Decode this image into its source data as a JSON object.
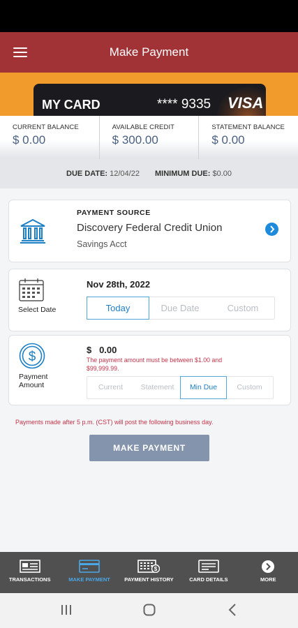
{
  "app": {
    "title": "Make Payment"
  },
  "card": {
    "name": "MY CARD",
    "number": "**** 9335",
    "brand": "VISA"
  },
  "balances": [
    {
      "label": "CURRENT BALANCE",
      "value": "$ 0.00"
    },
    {
      "label": "AVAILABLE CREDIT",
      "value": "$ 300.00"
    },
    {
      "label": "STATEMENT BALANCE",
      "value": "$ 0.00"
    }
  ],
  "due": {
    "date_label": "DUE DATE:",
    "date_value": "12/04/22",
    "min_label": "MINIMUM DUE:",
    "min_value": "$0.00"
  },
  "source": {
    "label": "PAYMENT SOURCE",
    "name": "Discovery Federal Credit Union",
    "account": "Savings Acct"
  },
  "date": {
    "label": "Select Date",
    "value": "Nov 28th, 2022",
    "options": [
      "Today",
      "Due Date",
      "Custom"
    ],
    "selected": "Today"
  },
  "amount": {
    "label_line1": "Payment",
    "label_line2": "Amount",
    "value": "$   0.00",
    "error": "The payment amount must be between $1.00 and $99,999.99.",
    "options": [
      "Current",
      "Statement",
      "Min Due",
      "Custom"
    ],
    "selected": "Min Due"
  },
  "note": "Payments made after 5 p.m. (CST) will post the following business day.",
  "pay_button": "MAKE PAYMENT",
  "tabs": [
    {
      "label": "TRANSACTIONS",
      "icon": "transactions-icon"
    },
    {
      "label": "MAKE PAYMENT",
      "icon": "payment-card-icon",
      "active": true
    },
    {
      "label": "PAYMENT HISTORY",
      "icon": "payment-history-icon"
    },
    {
      "label": "CARD DETAILS",
      "icon": "card-details-icon"
    },
    {
      "label": "MORE",
      "icon": "more-icon"
    }
  ],
  "colors": {
    "header": "#a13236",
    "accent": "#1d8adb",
    "error": "#c2334a",
    "button": "#8494ad",
    "tabbar": "#505050",
    "card_strip": "#f19b2c"
  }
}
